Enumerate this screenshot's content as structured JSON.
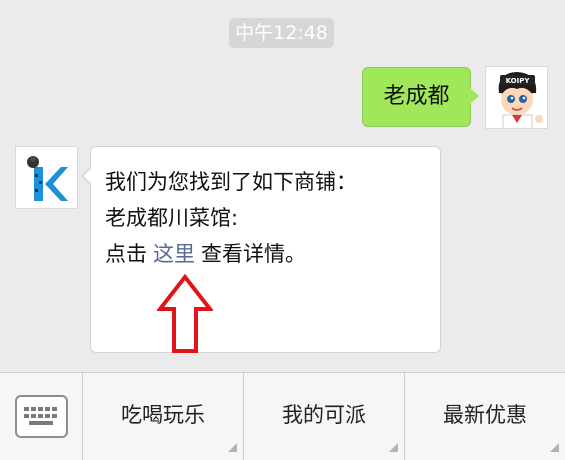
{
  "timestamp": "中午12:48",
  "outgoing": {
    "text": "老成都",
    "avatar_badge": "KOIPY",
    "bubble_color": "#a0e75a"
  },
  "incoming": {
    "line1": "我们为您找到了如下商铺：",
    "line2": "老成都川菜馆:",
    "line3_prefix": "点击",
    "link_text": "这里",
    "line3_suffix": "查看详情。",
    "link_color": "#576b95",
    "arrow_color": "#e0151b",
    "avatar_icon": "k-logo-icon"
  },
  "menu": {
    "keyboard_icon": "keyboard-icon",
    "items": [
      {
        "label": "吃喝玩乐"
      },
      {
        "label": "我的可派"
      },
      {
        "label": "最新优惠"
      }
    ]
  }
}
